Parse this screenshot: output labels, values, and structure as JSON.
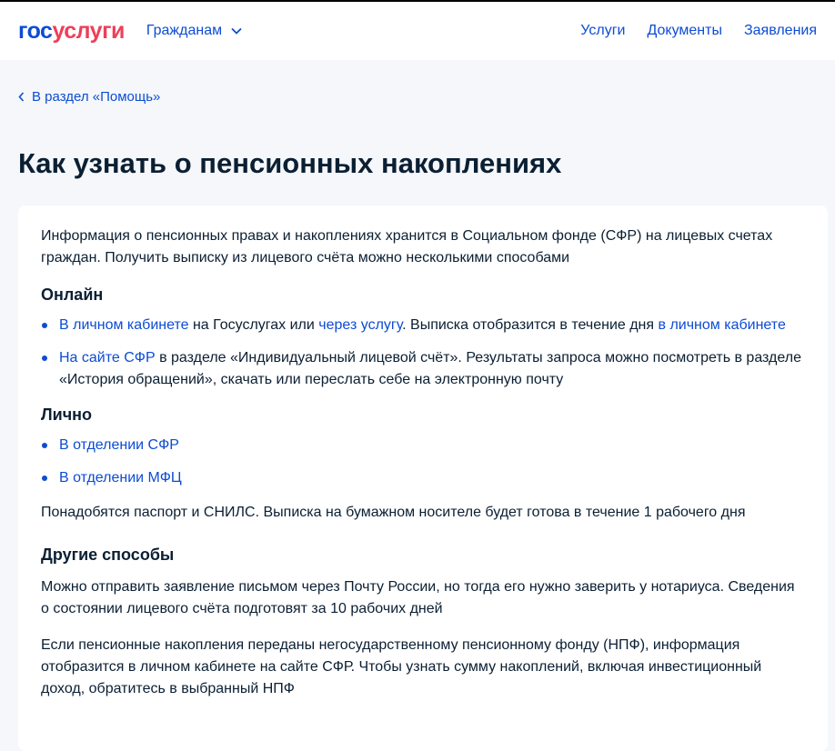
{
  "header": {
    "logo_a": "гос",
    "logo_b": "услуги",
    "citizens": "Гражданам",
    "nav": [
      "Услуги",
      "Документы",
      "Заявления"
    ]
  },
  "back": "В раздел «Помощь»",
  "title": "Как узнать о пенсионных накоплениях",
  "intro": "Информация о пенсионных правах и накоплениях хранится в Социальном фонде (СФР) на лицевых счетах граждан. Получить выписку из лицевого счёта можно несколькими способами",
  "online": {
    "heading": "Онлайн",
    "item1": {
      "link1": "В личном кабинете",
      "t1": " на Госуслугах или ",
      "link2": "через услугу",
      "t2": ". Выписка отобразится в течение дня ",
      "link3": "в личном кабинете"
    },
    "item2": {
      "link": "На сайте СФР",
      "text": " в разделе «Индивидуальный лицевой счёт». Результаты запроса можно посмотреть в разделе «История обращений», скачать или переслать себе на электронную почту"
    }
  },
  "personal": {
    "heading": "Лично",
    "items": [
      "В отделении СФР",
      "В отделении МФЦ"
    ],
    "note": "Понадобятся паспорт и СНИЛС. Выписка на бумажном носителе будет готова в течение 1 рабочего дня"
  },
  "other": {
    "heading": "Другие способы",
    "p1": "Можно отправить заявление письмом через Почту России, но тогда его нужно заверить у нотариуса. Сведения о состоянии лицевого счёта подготовят за 10 рабочих дней",
    "p2": "Если пенсионные накопления переданы негосударственному пенсионному фонду (НПФ), информация отобразится в личном кабинете на сайте СФР. Чтобы узнать сумму накоплений, включая инвестиционный доход, обратитесь в выбранный НПФ"
  }
}
